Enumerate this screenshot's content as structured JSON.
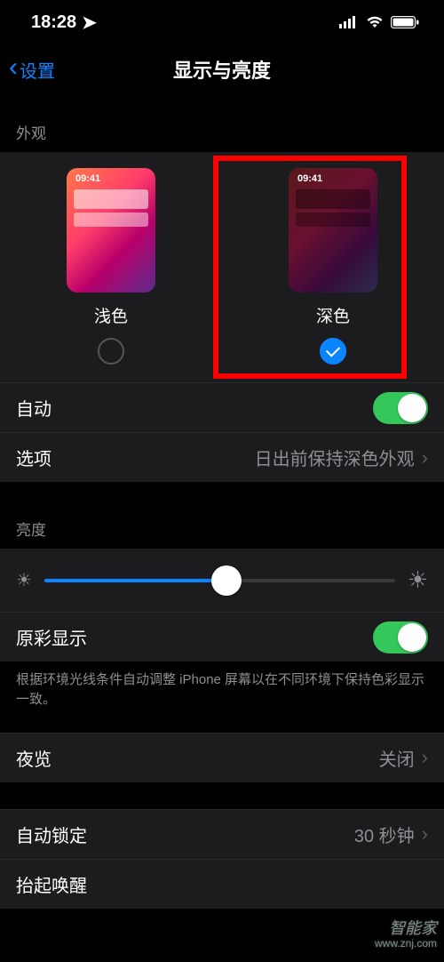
{
  "status": {
    "time": "18:28",
    "location_icon": "➤"
  },
  "nav": {
    "back_label": "设置",
    "title": "显示与亮度"
  },
  "appearance": {
    "header": "外观",
    "preview_time": "09:41",
    "light_label": "浅色",
    "dark_label": "深色",
    "selected": "dark"
  },
  "auto_row": {
    "label": "自动",
    "enabled": true
  },
  "options_row": {
    "label": "选项",
    "value": "日出前保持深色外观"
  },
  "brightness": {
    "header": "亮度",
    "value_percent": 52
  },
  "true_tone": {
    "label": "原彩显示",
    "enabled": true,
    "footer": "根据环境光线条件自动调整 iPhone 屏幕以在不同环境下保持色彩显示一致。"
  },
  "night_shift": {
    "label": "夜览",
    "value": "关闭"
  },
  "auto_lock": {
    "label": "自动锁定",
    "value": "30 秒钟"
  },
  "raise_to_wake": {
    "label": "抬起唤醒"
  },
  "watermark": {
    "brand": "智能家",
    "url": "www.znj.com"
  }
}
